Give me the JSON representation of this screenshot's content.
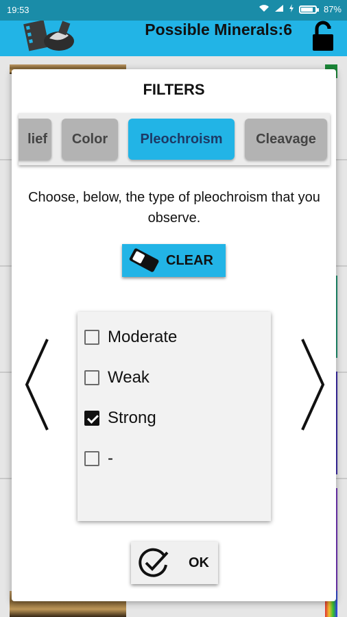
{
  "status": {
    "time": "19:53",
    "battery": "87%"
  },
  "appbar": {
    "title": "Possible Minerals:6"
  },
  "dialog": {
    "title": "FILTERS",
    "tabs": [
      {
        "label": "lief"
      },
      {
        "label": "Color"
      },
      {
        "label": "Pleochroism"
      },
      {
        "label": "Cleavage"
      }
    ],
    "active_tab": "Pleochroism",
    "instruction": "Choose, below, the type of pleochroism that you observe.",
    "clear_label": "CLEAR",
    "options": [
      {
        "label": "Moderate",
        "checked": false
      },
      {
        "label": "Weak",
        "checked": false
      },
      {
        "label": "Strong",
        "checked": true
      },
      {
        "label": "-",
        "checked": false
      }
    ],
    "ok_label": "OK"
  },
  "colors": {
    "accent": "#22b4e6",
    "statusbar": "#1a8ca8",
    "tab_inactive": "#b3b3b3"
  }
}
